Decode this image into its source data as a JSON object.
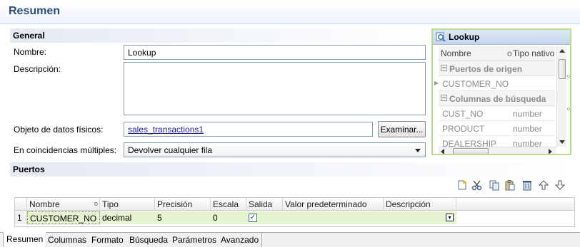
{
  "window": {
    "title": "Resumen"
  },
  "general": {
    "heading": "General",
    "name_label": "Nombre:",
    "name_value": "Lookup",
    "description_label": "Descripción:",
    "description_value": "",
    "physical_label": "Objeto de datos físicos:",
    "physical_value": "sales_transactions1",
    "browse_button": "Examinar...",
    "multiple_label": "En coincidencias múltiples:",
    "multiple_value": "Devolver cualquier fila"
  },
  "lookup_panel": {
    "title": "Lookup",
    "col_name": "Nombre",
    "col_type": "Tipo nativo",
    "groups": [
      {
        "label": "Puertos de origen",
        "rows": [
          {
            "name": "CUSTOMER_NO",
            "type": ""
          }
        ]
      },
      {
        "label": "Columnas de búsqueda",
        "rows": [
          {
            "name": "CUST_NO",
            "type": "number"
          },
          {
            "name": "PRODUCT",
            "type": "number"
          },
          {
            "name": "DEALERSHIP",
            "type": "number"
          }
        ]
      }
    ]
  },
  "ports": {
    "heading": "Puertos",
    "columns": [
      "Nombre",
      "Tipo",
      "Precisión",
      "Escala",
      "Salida",
      "Valor predeterminado",
      "Descripción"
    ],
    "rows": [
      {
        "index": "1",
        "name": "CUSTOMER_NO",
        "type": "decimal",
        "precision": "5",
        "scale": "0",
        "output": true,
        "default": "",
        "description": ""
      }
    ],
    "toolbar_icons": [
      "new-port-icon",
      "cut-icon",
      "copy-icon",
      "paste-icon",
      "delete-icon",
      "move-up-icon",
      "move-down-icon"
    ]
  },
  "tabs": [
    "Resumen",
    "Columnas",
    "Formato",
    "Búsqueda",
    "Parámetros",
    "Avanzado"
  ],
  "colors": {
    "title": "#2a4d7b",
    "highlight_row": "#e5f3d1",
    "lookup_border": "#b6dc8a",
    "link": "#1e1e9a"
  }
}
